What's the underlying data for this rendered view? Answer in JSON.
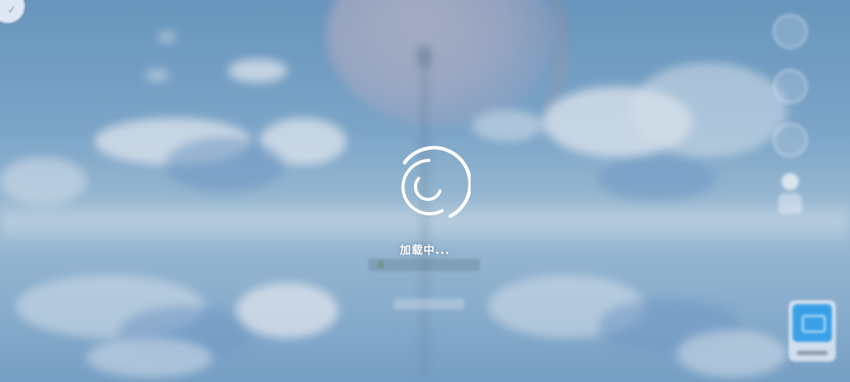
{
  "loading": {
    "label": "加载中..."
  },
  "colors": {
    "spinner": "#ffffff",
    "sky_top": "#6f9ec6",
    "sky_mid": "#a9c8df",
    "card_accent": "#3aa0e6"
  },
  "icons": {
    "avatar": "profile-avatar-icon",
    "side_1": "menu-icon",
    "side_2": "compass-icon",
    "side_3": "map-icon",
    "side_4": "character-icon",
    "bottom_card": "app-card-icon",
    "spinner": "loading-spinner-icon"
  }
}
